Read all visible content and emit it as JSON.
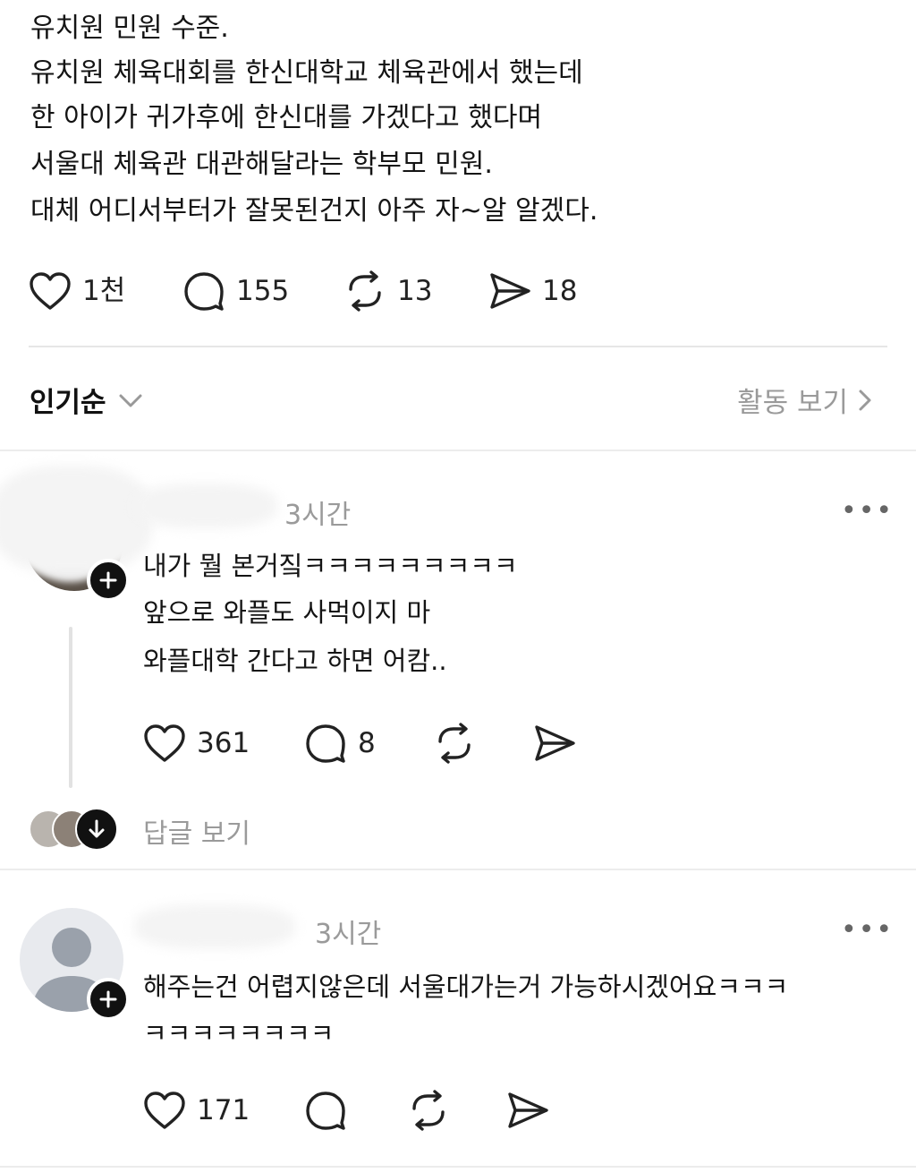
{
  "post": {
    "lines": [
      "유치원 민원 수준.",
      "유치원 체육대회를 한신대학교 체육관에서 했는데",
      "한 아이가 귀가후에 한신대를 가겠다고 했다며",
      "서울대 체육관 대관해달라는 학부모 민원.",
      "대체 어디서부터가 잘못된건지 아주 자~알 알겠다."
    ],
    "likes": "1천",
    "comments": "155",
    "reposts": "13",
    "shares": "18"
  },
  "sort": {
    "label": "인기순",
    "activity_link": "활동 보기"
  },
  "replies": [
    {
      "time": "3시간",
      "more": "•••",
      "lines": [
        "내가 뭘 본거짘ㅋㅋㅋㅋㅋㅋㅋㅋㅋ",
        "앞으로 와플도 사먹이지 마",
        "와플대학 간다고 하면 어캄.."
      ],
      "likes": "361",
      "comments": "8",
      "view_replies": "답글 보기"
    },
    {
      "time": "3시간",
      "more": "•••",
      "lines": [
        "해주는건 어렵지않은데 서울대가는거 가능하시겠어요ㅋㅋㅋ",
        "ㅋㅋㅋㅋㅋㅋㅋㅋ"
      ],
      "likes": "171"
    }
  ],
  "icons": {
    "like": "heart-icon",
    "comment": "comment-bubble-icon",
    "repost": "repost-icon",
    "share": "send-icon",
    "chevron": "chevron-down-icon",
    "chevron_right": "chevron-right-icon",
    "follow": "plus-icon",
    "expand": "arrow-down-icon",
    "avatar": "default-avatar-icon"
  }
}
